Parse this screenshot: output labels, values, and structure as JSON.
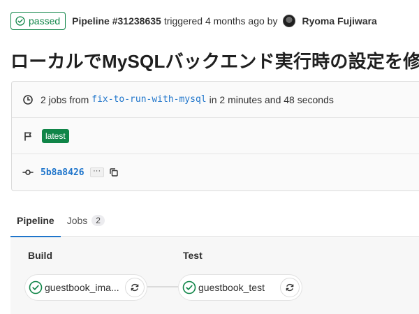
{
  "header": {
    "status": "passed",
    "pipeline_id": "Pipeline #31238635",
    "meta": "triggered 4 months ago by",
    "user": "Ryoma Fujiwara"
  },
  "title": "ローカルでMySQLバックエンド実行時の設定を修正",
  "info": {
    "jobs_prefix": "2 jobs from",
    "branch": "fix-to-run-with-mysql",
    "duration": "in 2 minutes and 48 seconds",
    "tag": "latest",
    "sha": "5b8a8426",
    "ellipsis": "···"
  },
  "tabs": [
    {
      "label": "Pipeline",
      "active": true
    },
    {
      "label": "Jobs",
      "count": "2"
    }
  ],
  "stages": [
    {
      "title": "Build",
      "job": "guestbook_ima..."
    },
    {
      "title": "Test",
      "job": "guestbook_test"
    }
  ],
  "colors": {
    "success": "#108548",
    "link": "#1f75cb",
    "tab_underline": "#1f75cb"
  },
  "icons": {
    "status": "check-circle-icon",
    "clock": "clock-icon",
    "flag": "flag-icon",
    "commit": "commit-icon",
    "copy": "copy-icon",
    "retry": "retry-icon"
  }
}
